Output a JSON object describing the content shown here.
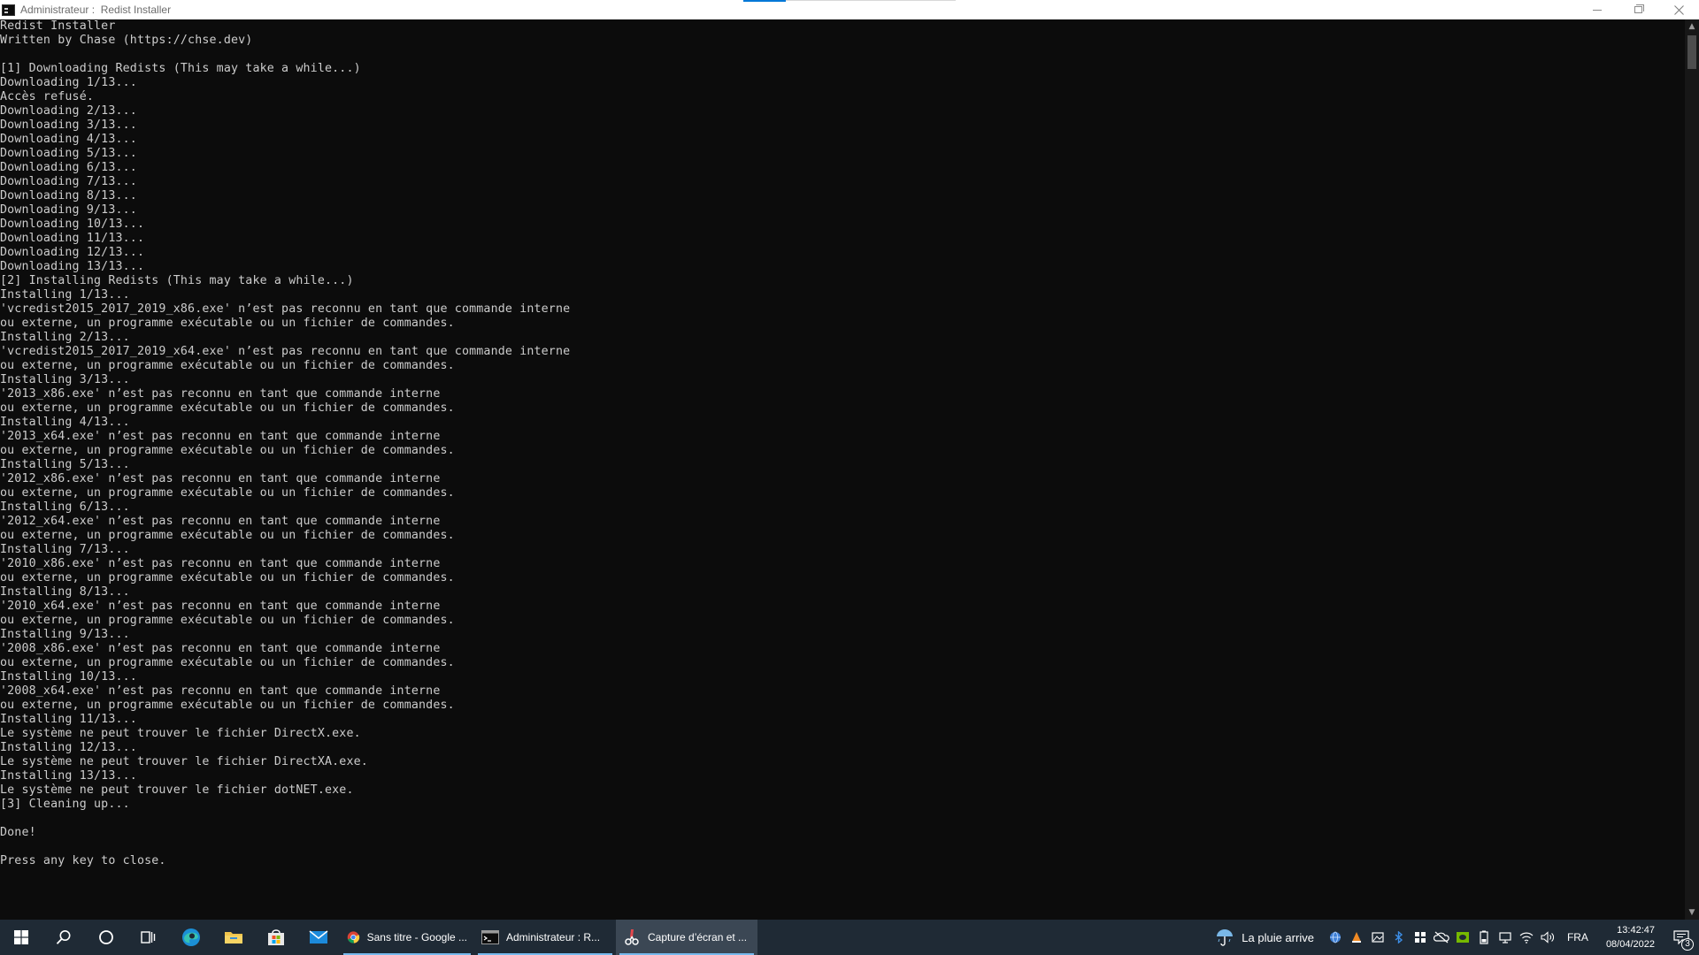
{
  "window": {
    "title": "Administrateur :  Redist Installer"
  },
  "console": {
    "lines": [
      "Redist Installer",
      "Written by Chase (https://chse.dev)",
      "",
      "[1] Downloading Redists (This may take a while...)",
      "Downloading 1/13...",
      "Accès refusé.",
      "Downloading 2/13...",
      "Downloading 3/13...",
      "Downloading 4/13...",
      "Downloading 5/13...",
      "Downloading 6/13...",
      "Downloading 7/13...",
      "Downloading 8/13...",
      "Downloading 9/13...",
      "Downloading 10/13...",
      "Downloading 11/13...",
      "Downloading 12/13...",
      "Downloading 13/13...",
      "[2] Installing Redists (This may take a while...)",
      "Installing 1/13...",
      "'vcredist2015_2017_2019_x86.exe' n’est pas reconnu en tant que commande interne",
      "ou externe, un programme exécutable ou un fichier de commandes.",
      "Installing 2/13...",
      "'vcredist2015_2017_2019_x64.exe' n’est pas reconnu en tant que commande interne",
      "ou externe, un programme exécutable ou un fichier de commandes.",
      "Installing 3/13...",
      "'2013_x86.exe' n’est pas reconnu en tant que commande interne",
      "ou externe, un programme exécutable ou un fichier de commandes.",
      "Installing 4/13...",
      "'2013_x64.exe' n’est pas reconnu en tant que commande interne",
      "ou externe, un programme exécutable ou un fichier de commandes.",
      "Installing 5/13...",
      "'2012_x86.exe' n’est pas reconnu en tant que commande interne",
      "ou externe, un programme exécutable ou un fichier de commandes.",
      "Installing 6/13...",
      "'2012_x64.exe' n’est pas reconnu en tant que commande interne",
      "ou externe, un programme exécutable ou un fichier de commandes.",
      "Installing 7/13...",
      "'2010_x86.exe' n’est pas reconnu en tant que commande interne",
      "ou externe, un programme exécutable ou un fichier de commandes.",
      "Installing 8/13...",
      "'2010_x64.exe' n’est pas reconnu en tant que commande interne",
      "ou externe, un programme exécutable ou un fichier de commandes.",
      "Installing 9/13...",
      "'2008_x86.exe' n’est pas reconnu en tant que commande interne",
      "ou externe, un programme exécutable ou un fichier de commandes.",
      "Installing 10/13...",
      "'2008_x64.exe' n’est pas reconnu en tant que commande interne",
      "ou externe, un programme exécutable ou un fichier de commandes.",
      "Installing 11/13...",
      "Le système ne peut trouver le fichier DirectX.exe.",
      "Installing 12/13...",
      "Le système ne peut trouver le fichier DirectXA.exe.",
      "Installing 13/13...",
      "Le système ne peut trouver le fichier dotNET.exe.",
      "[3] Cleaning up...",
      "",
      "Done!",
      "",
      "Press any key to close."
    ]
  },
  "taskbar": {
    "start_icon": "windows-start-icon",
    "pinned": [
      {
        "icon": "search-icon"
      },
      {
        "icon": "cortana-circle-icon"
      },
      {
        "icon": "task-view-icon"
      },
      {
        "icon": "edge-browser-icon"
      },
      {
        "icon": "file-explorer-icon"
      },
      {
        "icon": "microsoft-store-icon"
      },
      {
        "icon": "mail-icon"
      }
    ],
    "open_apps": [
      {
        "icon": "chrome-icon",
        "label": "Sans titre - Google ..."
      },
      {
        "icon": "terminal-icon",
        "label": "Administrateur : R..."
      },
      {
        "icon": "snipping-tool-icon",
        "label": "Capture d’écran et ..."
      }
    ],
    "weather": {
      "icon": "umbrella-rain-icon",
      "label": "La pluie arrive"
    },
    "tray_icons": [
      "network-globe-icon",
      "vlc-icon",
      "image-app-icon",
      "bluetooth-icon",
      "app-grid-icon",
      "onedrive-offline-icon",
      "nvidia-icon",
      "battery-icon",
      "display-icon",
      "wifi-icon",
      "volume-icon"
    ],
    "language": "FRA",
    "time": "13:42:47",
    "date": "08/04/2022",
    "notifications_count": "3"
  },
  "colors": {
    "console_bg": "#0c0c0c",
    "console_text": "#cccccc",
    "taskbar_bg": "#1f2a35",
    "accent": "#0078d7"
  }
}
